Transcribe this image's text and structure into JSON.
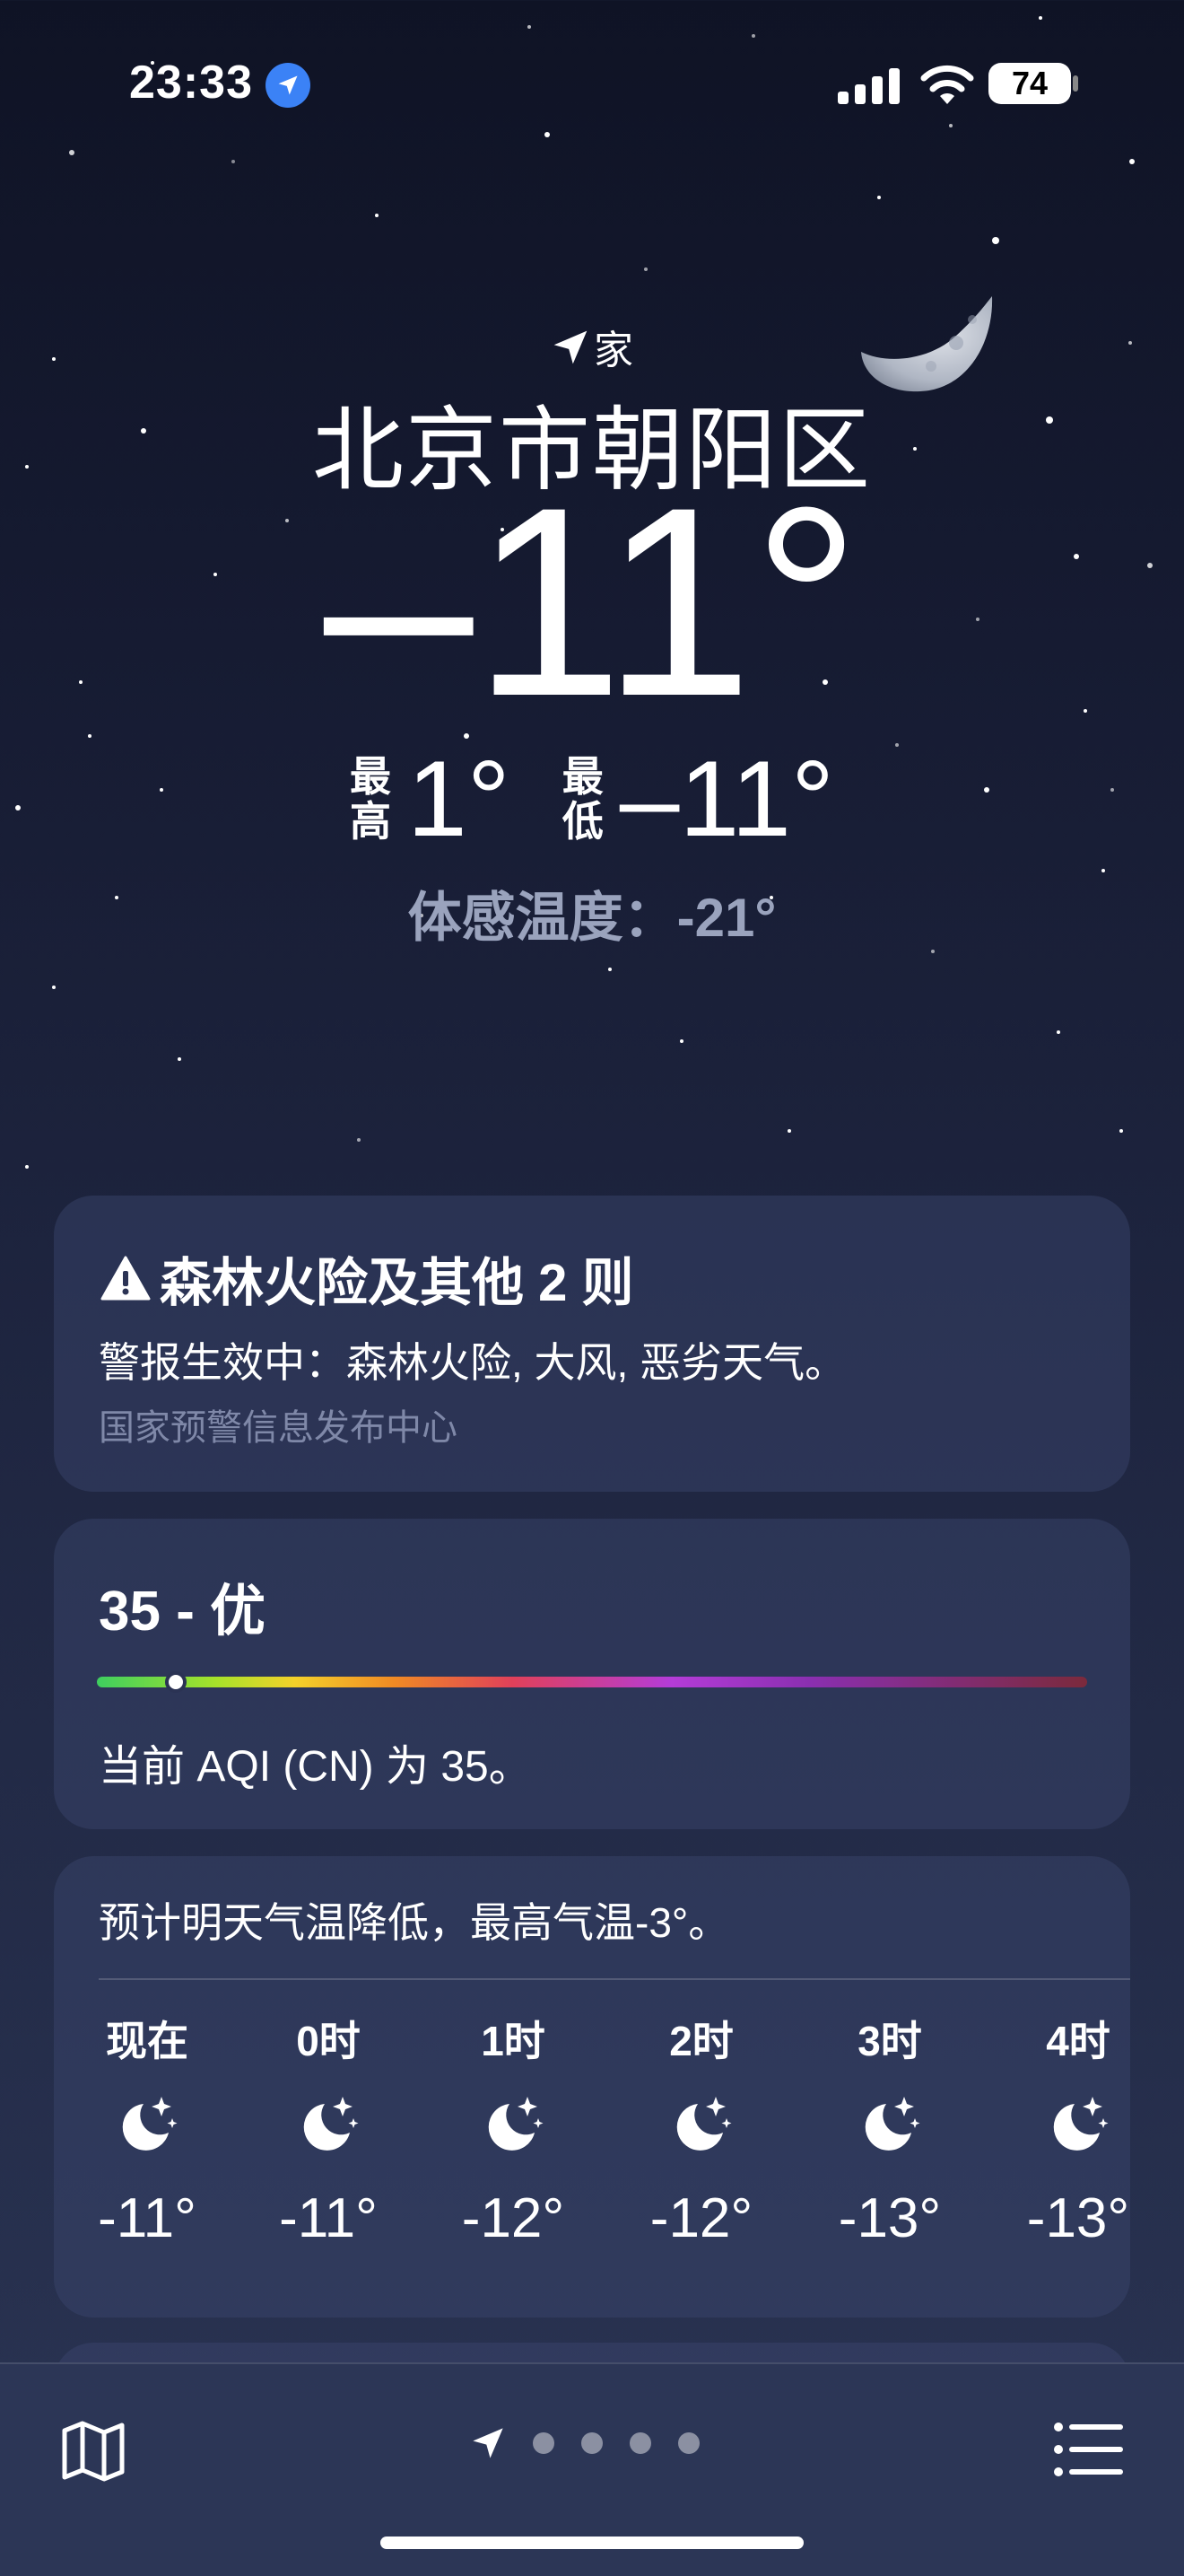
{
  "status_bar": {
    "time": "23:33",
    "battery": "74"
  },
  "location": {
    "home_label": "家",
    "city": "北京市朝阳区"
  },
  "current": {
    "temperature": "–11°",
    "high_label_top": "最",
    "high_label_bottom": "高",
    "high": "1°",
    "low_label_top": "最",
    "low_label_bottom": "低",
    "low": "–11°",
    "feels_like": "体感温度：-21°"
  },
  "alert": {
    "title": "森林火险及其他 2 则",
    "body": "警报生效中：森林火险, 大风, 恶劣天气。",
    "source": "国家预警信息发布中心"
  },
  "aqi": {
    "value_text": "35 - 优",
    "description": "当前 AQI (CN) 为 35。",
    "indicator_fraction": 0.08
  },
  "forecast": {
    "summary": "预计明天气温降低，最高气温-3°。",
    "hours": [
      {
        "label": "现在",
        "icon": "moon-stars-icon",
        "temp": "-11°"
      },
      {
        "label": "0时",
        "icon": "moon-stars-icon",
        "temp": "-11°"
      },
      {
        "label": "1时",
        "icon": "moon-stars-icon",
        "temp": "-12°"
      },
      {
        "label": "2时",
        "icon": "moon-stars-icon",
        "temp": "-12°"
      },
      {
        "label": "3时",
        "icon": "moon-stars-icon",
        "temp": "-13°"
      },
      {
        "label": "4时",
        "icon": "moon-stars-icon",
        "temp": "-13°"
      }
    ]
  },
  "bottom_bar": {
    "page_dots": 4
  }
}
